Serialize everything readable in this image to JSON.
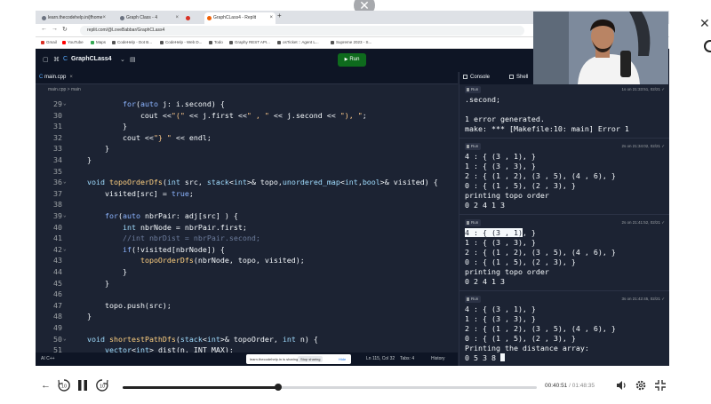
{
  "browser": {
    "tabs": [
      {
        "label": "learn.thecodehelp.in/jfhome",
        "active": false
      },
      {
        "label": "Graph Class - 4",
        "active": false
      },
      {
        "label": "",
        "active": false
      },
      {
        "label": "GraphCLass4 - Replit",
        "active": true
      }
    ],
    "url": "replit.com/@LoveBabbar/GraphCLass4",
    "bookmarks": [
      "Gmail",
      "YouTube",
      "Maps",
      "CodeHelp - Dot B...",
      "CodeHelp - Web D...",
      "Todo",
      "Graphy REST API...",
      "osTicket :: Agent L...",
      "Supreme 2023 - S..."
    ]
  },
  "replit": {
    "project_name": "GraphCLass4",
    "run_label": "Run",
    "editor_tab": "main.cpp",
    "breadcrumb": "main.cpp  >  main",
    "status_left": "AI  C++",
    "status_right": "Ln 115, Col 32",
    "status_tabs": "Tabs: 4",
    "status_history": "History",
    "console_tabs": [
      "Console",
      "Shell"
    ]
  },
  "code_lines": [
    {
      "n": "29",
      "fold": true,
      "html": "        <span class='kw'>for</span>(<span class='kw'>auto</span> j: i.second) {"
    },
    {
      "n": "30",
      "fold": false,
      "html": "            cout &lt;&lt;<span class='st'>\"(\"</span> &lt;&lt; j.first &lt;&lt;<span class='st'>\" , \"</span> &lt;&lt; j.second &lt;&lt; <span class='st'>\"), \"</span>;"
    },
    {
      "n": "31",
      "fold": false,
      "html": "        }"
    },
    {
      "n": "32",
      "fold": false,
      "html": "        cout &lt;&lt;<span class='st'>\"} \"</span> &lt;&lt; endl;"
    },
    {
      "n": "33",
      "fold": false,
      "html": "    }"
    },
    {
      "n": "34",
      "fold": false,
      "html": "}"
    },
    {
      "n": "35",
      "fold": false,
      "html": ""
    },
    {
      "n": "36",
      "fold": true,
      "html": "<span class='ty'>void</span> <span class='fn'>topoOrderDfs</span>(<span class='ty'>int</span> src, <span class='ty'>stack</span>&lt;<span class='ty'>int</span>&gt;&amp; topo,<span class='ty'>unordered_map</span>&lt;<span class='ty'>int</span>,<span class='ty'>bool</span>&gt;&amp; visited) {"
    },
    {
      "n": "37",
      "fold": false,
      "html": "    visited[src] = <span class='kw'>true</span>;"
    },
    {
      "n": "38",
      "fold": false,
      "html": ""
    },
    {
      "n": "39",
      "fold": true,
      "html": "    <span class='kw'>for</span>(<span class='kw'>auto</span> nbrPair: adj[src] ) {"
    },
    {
      "n": "40",
      "fold": false,
      "html": "        <span class='ty'>int</span> nbrNode = nbrPair.first;"
    },
    {
      "n": "41",
      "fold": false,
      "html": "        <span class='cm'>//int nbrDist = nbrPair.second;</span>"
    },
    {
      "n": "42",
      "fold": true,
      "html": "        <span class='kw'>if</span>(!visited[nbrNode]) {"
    },
    {
      "n": "43",
      "fold": false,
      "html": "            <span class='fn'>topoOrderDfs</span>(nbrNode, topo, visited);"
    },
    {
      "n": "44",
      "fold": false,
      "html": "        }"
    },
    {
      "n": "45",
      "fold": false,
      "html": "    }"
    },
    {
      "n": "46",
      "fold": false,
      "html": ""
    },
    {
      "n": "47",
      "fold": false,
      "html": "    topo.push(src);"
    },
    {
      "n": "48",
      "fold": false,
      "html": "}"
    },
    {
      "n": "49",
      "fold": false,
      "html": ""
    },
    {
      "n": "50",
      "fold": true,
      "html": "<span class='ty'>void</span> <span class='fn'>shortestPathDfs</span>(<span class='ty'>stack</span>&lt;<span class='ty'>int</span>&gt;&amp; topoOrder, <span class='ty'>int</span> n) {"
    },
    {
      "n": "51",
      "fold": false,
      "html": "    <span class='ty'>vector</span>&lt;<span class='ty'>int</span>&gt; dist(n, INT_MAX);"
    }
  ],
  "console_runs": [
    {
      "time": "1s on 21:33:51, 02/21",
      "lines": [
        ".second;",
        "",
        "1 error generated.",
        "make: *** [Makefile:10: main] Error 1"
      ]
    },
    {
      "time": "2s on 21:34:02, 02/21",
      "lines": [
        "4 : { (3 , 1), }",
        "1 : { (3 , 3), }",
        "2 : { (1 , 2), (3 , 5), (4 , 6), }",
        "0 : { (1 , 5), (2 , 3), }",
        "printing topo order",
        "0 2 4 1 3"
      ]
    },
    {
      "time": "2s on 21:41:52, 02/21",
      "lines": [
        "4 : { (3 , 1), }",
        "1 : { (3 , 3), }",
        "2 : { (1 , 2), (3 , 5), (4 , 6), }",
        "0 : { (1 , 5), (2 , 3), }",
        "printing topo order",
        "0 2 4 1 3"
      ]
    },
    {
      "time": "3s on 21:42:45, 02/21",
      "lines": [
        "4 : { (3 , 1), }",
        "1 : { (3 , 3), }",
        "2 : { (1 , 2), (3 , 5), (4 , 6), }",
        "0 : { (1 , 5), (2 , 3), }",
        "Printing the distance array:",
        "0 5 3 8 "
      ]
    }
  ],
  "run_chip_label": "Run",
  "share_banner": {
    "message": "learn.thecodehelp.in is sharing your screen.",
    "stop": "Stop sharing",
    "hide": "Hide"
  },
  "player": {
    "current_time": "00:40:51",
    "duration": "/ 01:48:35",
    "progress": 0.376,
    "skip_back": "10",
    "skip_forward": "10"
  },
  "colors": {
    "accent_run": "#0e6b1d",
    "editor_bg": "#1c2333",
    "topbar_bg": "#0e1525"
  }
}
